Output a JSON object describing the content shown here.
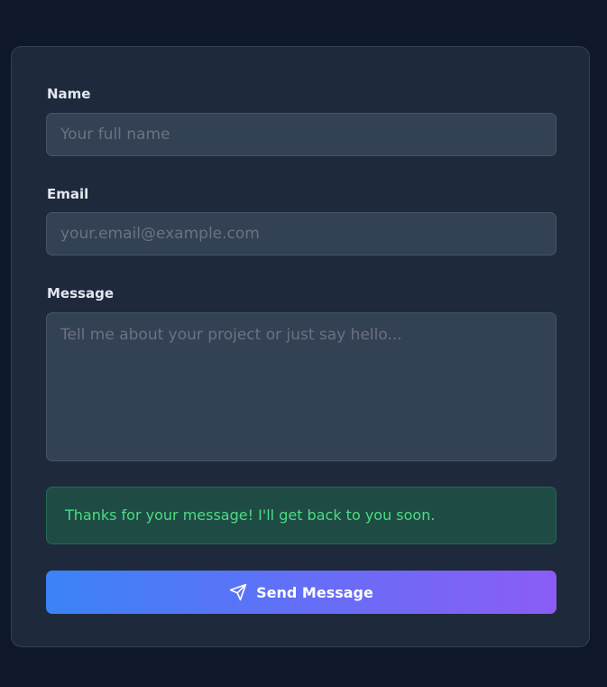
{
  "form": {
    "name": {
      "label": "Name",
      "placeholder": "Your full name",
      "value": ""
    },
    "email": {
      "label": "Email",
      "placeholder": "your.email@example.com",
      "value": ""
    },
    "message": {
      "label": "Message",
      "placeholder": "Tell me about your project or just say hello...",
      "value": ""
    },
    "success_message": "Thanks for your message! I'll get back to you soon.",
    "submit": {
      "label": "Send Message",
      "icon": "send-icon"
    }
  },
  "colors": {
    "page_background": "#0f172a",
    "card_background": "#1e293b",
    "input_background": "#334155",
    "success_text": "#4ade80",
    "success_background": "#1f4b45",
    "button_gradient_start": "#3b82f6",
    "button_gradient_end": "#8b5cf6"
  }
}
